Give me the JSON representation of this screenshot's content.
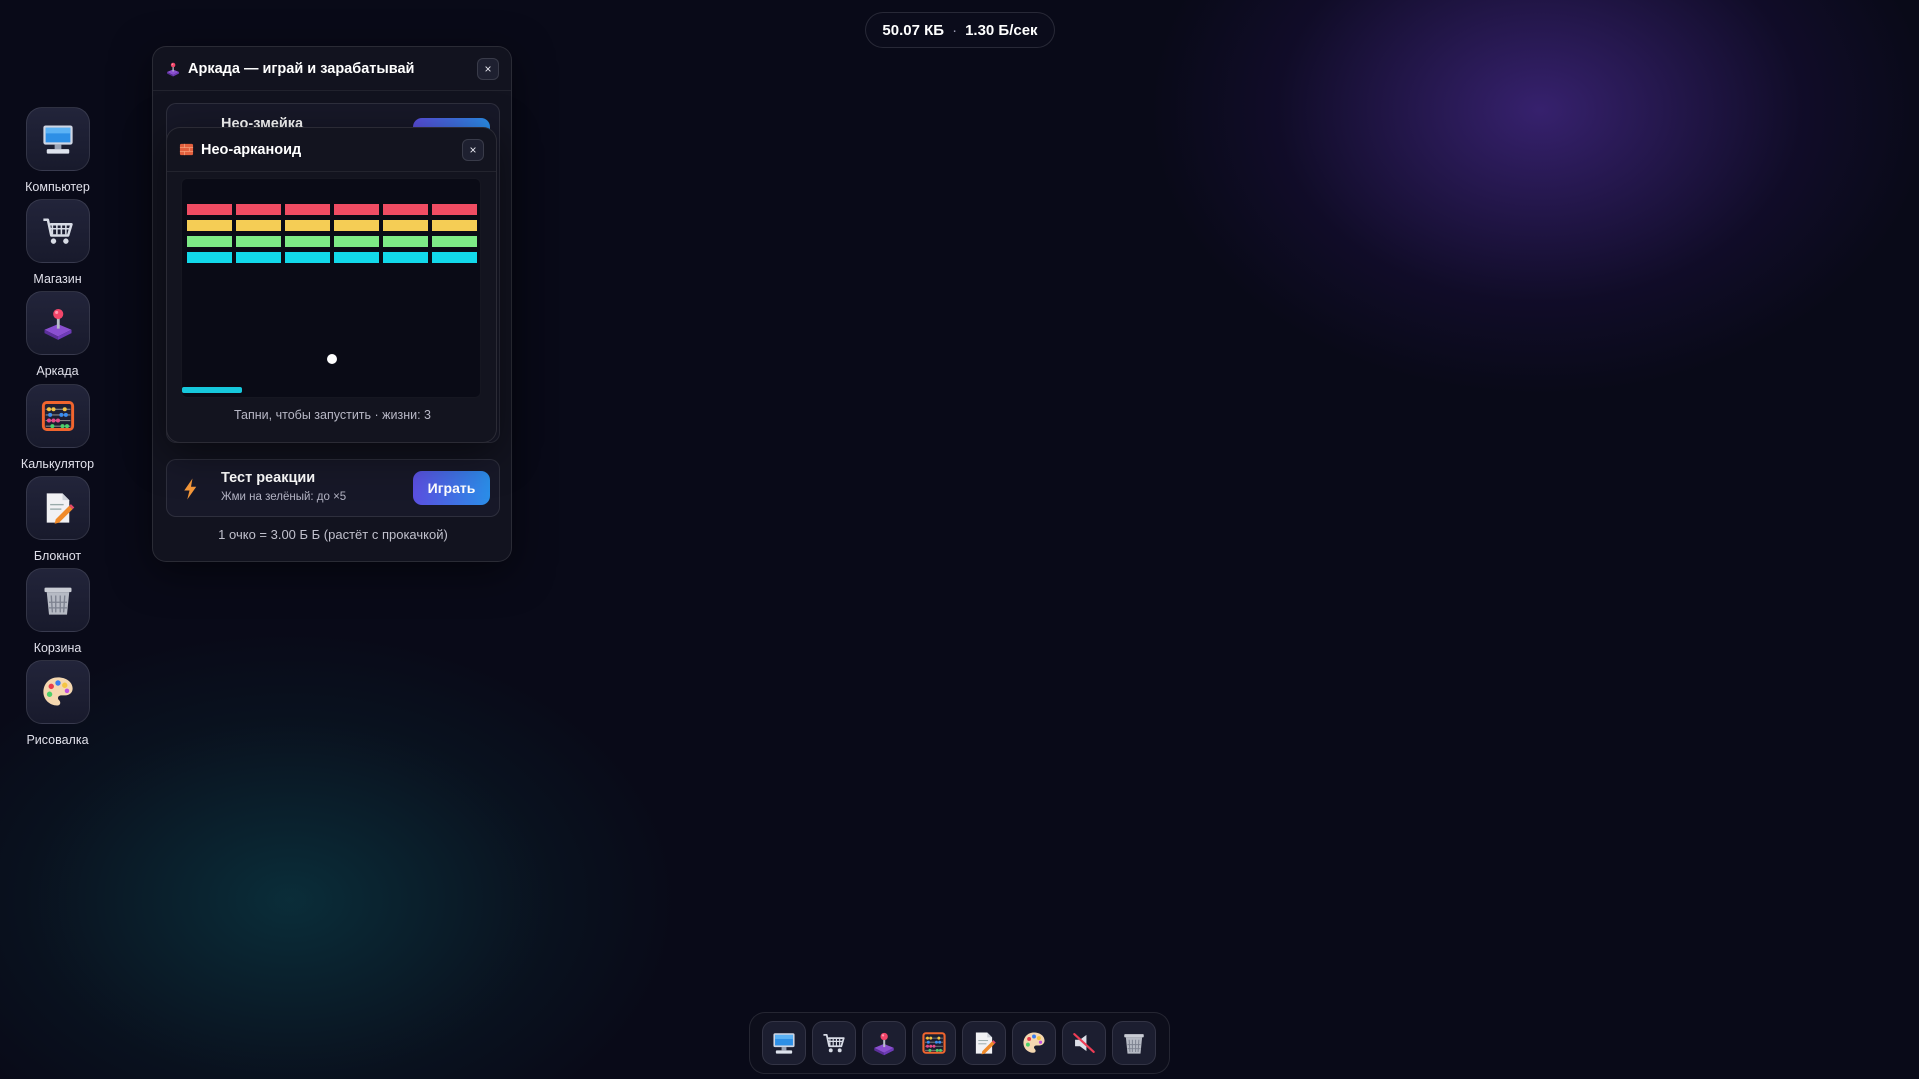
{
  "status": {
    "storage": "50.07 КБ",
    "rate": "1.30 Б/сек",
    "separator": "·"
  },
  "desktop": [
    {
      "label": "Компьютер",
      "icon": "computer-icon"
    },
    {
      "label": "Магазин",
      "icon": "shopping-cart-icon"
    },
    {
      "label": "Аркада",
      "icon": "joystick-icon"
    },
    {
      "label": "Калькулятор",
      "icon": "abacus-icon"
    },
    {
      "label": "Блокнот",
      "icon": "notepad-icon"
    },
    {
      "label": "Корзина",
      "icon": "trash-icon"
    },
    {
      "label": "Рисовалка",
      "icon": "palette-icon"
    }
  ],
  "arcade": {
    "title": "Аркада — играй и зарабатывай",
    "close": "×",
    "games": [
      {
        "name": "Нео-змейка",
        "icon": "snake-icon"
      },
      {
        "name": "Тест реакции",
        "desc": "Жми на зелёный: до ×5",
        "play": "Играть",
        "icon": "lightning-icon"
      }
    ],
    "footer": "1 очко = 3.00 Б Б (растёт с прокачкой)"
  },
  "arkanoid": {
    "title": "Нео-арканоид",
    "close": "×",
    "hint": "Тапни, чтобы запустить · жизни: 3",
    "lives": 3,
    "brick_rows": 4,
    "brick_cols": 6,
    "row_colors": [
      "#f04c63",
      "#f5cd55",
      "#7dea86",
      "#12d9ea"
    ],
    "paddle_color": "#16c8dc"
  },
  "taskbar": [
    {
      "icon": "computer-icon"
    },
    {
      "icon": "shopping-cart-icon"
    },
    {
      "icon": "joystick-icon"
    },
    {
      "icon": "abacus-icon"
    },
    {
      "icon": "notepad-icon"
    },
    {
      "icon": "palette-icon"
    },
    {
      "icon": "muted-speaker-icon"
    },
    {
      "icon": "trash-icon"
    }
  ]
}
